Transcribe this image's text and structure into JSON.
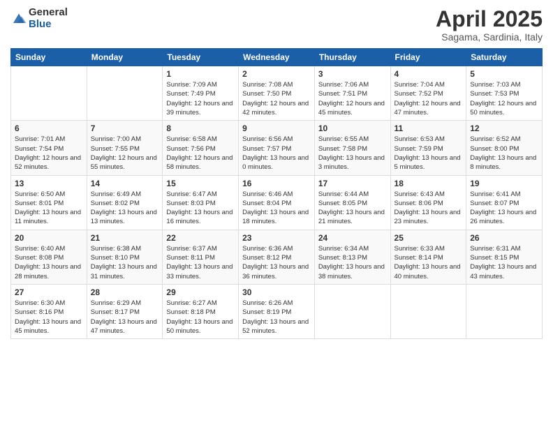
{
  "logo": {
    "general": "General",
    "blue": "Blue"
  },
  "title": "April 2025",
  "subtitle": "Sagama, Sardinia, Italy",
  "days_of_week": [
    "Sunday",
    "Monday",
    "Tuesday",
    "Wednesday",
    "Thursday",
    "Friday",
    "Saturday"
  ],
  "weeks": [
    [
      {
        "day": "",
        "sunrise": "",
        "sunset": "",
        "daylight": ""
      },
      {
        "day": "",
        "sunrise": "",
        "sunset": "",
        "daylight": ""
      },
      {
        "day": "1",
        "sunrise": "Sunrise: 7:09 AM",
        "sunset": "Sunset: 7:49 PM",
        "daylight": "Daylight: 12 hours and 39 minutes."
      },
      {
        "day": "2",
        "sunrise": "Sunrise: 7:08 AM",
        "sunset": "Sunset: 7:50 PM",
        "daylight": "Daylight: 12 hours and 42 minutes."
      },
      {
        "day": "3",
        "sunrise": "Sunrise: 7:06 AM",
        "sunset": "Sunset: 7:51 PM",
        "daylight": "Daylight: 12 hours and 45 minutes."
      },
      {
        "day": "4",
        "sunrise": "Sunrise: 7:04 AM",
        "sunset": "Sunset: 7:52 PM",
        "daylight": "Daylight: 12 hours and 47 minutes."
      },
      {
        "day": "5",
        "sunrise": "Sunrise: 7:03 AM",
        "sunset": "Sunset: 7:53 PM",
        "daylight": "Daylight: 12 hours and 50 minutes."
      }
    ],
    [
      {
        "day": "6",
        "sunrise": "Sunrise: 7:01 AM",
        "sunset": "Sunset: 7:54 PM",
        "daylight": "Daylight: 12 hours and 52 minutes."
      },
      {
        "day": "7",
        "sunrise": "Sunrise: 7:00 AM",
        "sunset": "Sunset: 7:55 PM",
        "daylight": "Daylight: 12 hours and 55 minutes."
      },
      {
        "day": "8",
        "sunrise": "Sunrise: 6:58 AM",
        "sunset": "Sunset: 7:56 PM",
        "daylight": "Daylight: 12 hours and 58 minutes."
      },
      {
        "day": "9",
        "sunrise": "Sunrise: 6:56 AM",
        "sunset": "Sunset: 7:57 PM",
        "daylight": "Daylight: 13 hours and 0 minutes."
      },
      {
        "day": "10",
        "sunrise": "Sunrise: 6:55 AM",
        "sunset": "Sunset: 7:58 PM",
        "daylight": "Daylight: 13 hours and 3 minutes."
      },
      {
        "day": "11",
        "sunrise": "Sunrise: 6:53 AM",
        "sunset": "Sunset: 7:59 PM",
        "daylight": "Daylight: 13 hours and 5 minutes."
      },
      {
        "day": "12",
        "sunrise": "Sunrise: 6:52 AM",
        "sunset": "Sunset: 8:00 PM",
        "daylight": "Daylight: 13 hours and 8 minutes."
      }
    ],
    [
      {
        "day": "13",
        "sunrise": "Sunrise: 6:50 AM",
        "sunset": "Sunset: 8:01 PM",
        "daylight": "Daylight: 13 hours and 11 minutes."
      },
      {
        "day": "14",
        "sunrise": "Sunrise: 6:49 AM",
        "sunset": "Sunset: 8:02 PM",
        "daylight": "Daylight: 13 hours and 13 minutes."
      },
      {
        "day": "15",
        "sunrise": "Sunrise: 6:47 AM",
        "sunset": "Sunset: 8:03 PM",
        "daylight": "Daylight: 13 hours and 16 minutes."
      },
      {
        "day": "16",
        "sunrise": "Sunrise: 6:46 AM",
        "sunset": "Sunset: 8:04 PM",
        "daylight": "Daylight: 13 hours and 18 minutes."
      },
      {
        "day": "17",
        "sunrise": "Sunrise: 6:44 AM",
        "sunset": "Sunset: 8:05 PM",
        "daylight": "Daylight: 13 hours and 21 minutes."
      },
      {
        "day": "18",
        "sunrise": "Sunrise: 6:43 AM",
        "sunset": "Sunset: 8:06 PM",
        "daylight": "Daylight: 13 hours and 23 minutes."
      },
      {
        "day": "19",
        "sunrise": "Sunrise: 6:41 AM",
        "sunset": "Sunset: 8:07 PM",
        "daylight": "Daylight: 13 hours and 26 minutes."
      }
    ],
    [
      {
        "day": "20",
        "sunrise": "Sunrise: 6:40 AM",
        "sunset": "Sunset: 8:08 PM",
        "daylight": "Daylight: 13 hours and 28 minutes."
      },
      {
        "day": "21",
        "sunrise": "Sunrise: 6:38 AM",
        "sunset": "Sunset: 8:10 PM",
        "daylight": "Daylight: 13 hours and 31 minutes."
      },
      {
        "day": "22",
        "sunrise": "Sunrise: 6:37 AM",
        "sunset": "Sunset: 8:11 PM",
        "daylight": "Daylight: 13 hours and 33 minutes."
      },
      {
        "day": "23",
        "sunrise": "Sunrise: 6:36 AM",
        "sunset": "Sunset: 8:12 PM",
        "daylight": "Daylight: 13 hours and 36 minutes."
      },
      {
        "day": "24",
        "sunrise": "Sunrise: 6:34 AM",
        "sunset": "Sunset: 8:13 PM",
        "daylight": "Daylight: 13 hours and 38 minutes."
      },
      {
        "day": "25",
        "sunrise": "Sunrise: 6:33 AM",
        "sunset": "Sunset: 8:14 PM",
        "daylight": "Daylight: 13 hours and 40 minutes."
      },
      {
        "day": "26",
        "sunrise": "Sunrise: 6:31 AM",
        "sunset": "Sunset: 8:15 PM",
        "daylight": "Daylight: 13 hours and 43 minutes."
      }
    ],
    [
      {
        "day": "27",
        "sunrise": "Sunrise: 6:30 AM",
        "sunset": "Sunset: 8:16 PM",
        "daylight": "Daylight: 13 hours and 45 minutes."
      },
      {
        "day": "28",
        "sunrise": "Sunrise: 6:29 AM",
        "sunset": "Sunset: 8:17 PM",
        "daylight": "Daylight: 13 hours and 47 minutes."
      },
      {
        "day": "29",
        "sunrise": "Sunrise: 6:27 AM",
        "sunset": "Sunset: 8:18 PM",
        "daylight": "Daylight: 13 hours and 50 minutes."
      },
      {
        "day": "30",
        "sunrise": "Sunrise: 6:26 AM",
        "sunset": "Sunset: 8:19 PM",
        "daylight": "Daylight: 13 hours and 52 minutes."
      },
      {
        "day": "",
        "sunrise": "",
        "sunset": "",
        "daylight": ""
      },
      {
        "day": "",
        "sunrise": "",
        "sunset": "",
        "daylight": ""
      },
      {
        "day": "",
        "sunrise": "",
        "sunset": "",
        "daylight": ""
      }
    ]
  ]
}
